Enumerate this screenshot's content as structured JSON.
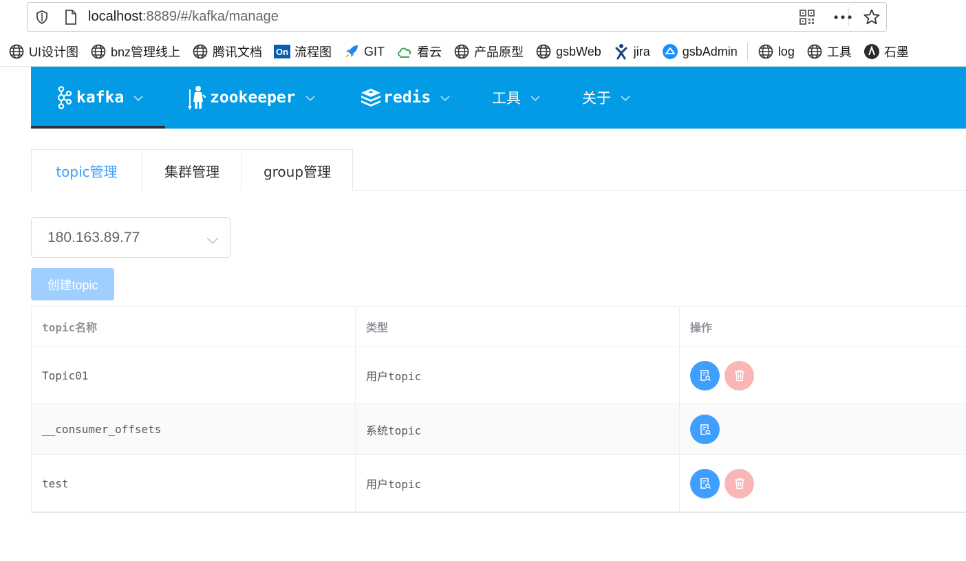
{
  "browser": {
    "url_host": "localhost",
    "url_rest": ":8889/#/kafka/manage",
    "icons": [
      "shield-icon",
      "page-icon",
      "qr-code-icon",
      "more-icon",
      "star-icon"
    ]
  },
  "bookmarks": [
    {
      "label": "UI设计图",
      "icon": "globe-icon"
    },
    {
      "label": "bnz管理线上",
      "icon": "globe-icon"
    },
    {
      "label": "腾讯文档",
      "icon": "globe-icon"
    },
    {
      "label": "流程图",
      "icon": "on-logo-icon"
    },
    {
      "label": "GIT",
      "icon": "rocket-icon"
    },
    {
      "label": "看云",
      "icon": "cloud-icon"
    },
    {
      "label": "产品原型",
      "icon": "globe-icon"
    },
    {
      "label": "gsbWeb",
      "icon": "globe-icon"
    },
    {
      "label": "jira",
      "icon": "jira-icon"
    },
    {
      "label": "gsbAdmin",
      "icon": "admin-icon"
    },
    {
      "label": "log",
      "icon": "globe-icon"
    },
    {
      "label": "工具",
      "icon": "globe-icon"
    },
    {
      "label": "石墨",
      "icon": "shimo-icon"
    }
  ],
  "nav": {
    "color": "#039be5",
    "items": [
      {
        "label": "kafka",
        "icon": "kafka-icon",
        "active": true
      },
      {
        "label": "zookeeper",
        "icon": "zookeeper-icon"
      },
      {
        "label": "redis",
        "icon": "redis-icon"
      },
      {
        "label": "工具"
      },
      {
        "label": "关于"
      }
    ]
  },
  "tabs": [
    {
      "label": "topic管理",
      "active": true
    },
    {
      "label": "集群管理"
    },
    {
      "label": "group管理"
    }
  ],
  "cluster_select": {
    "value": "180.163.89.77"
  },
  "create_button": {
    "label": "创建topic",
    "disabled": true
  },
  "table": {
    "headers": [
      "topic名称",
      "类型",
      "操作"
    ],
    "rows": [
      {
        "name": "Topic01",
        "type": "用户topic",
        "actions": [
          "view",
          "delete"
        ]
      },
      {
        "name": "__consumer_offsets",
        "type": "系统topic",
        "actions": [
          "view"
        ]
      },
      {
        "name": "test",
        "type": "用户topic",
        "actions": [
          "view",
          "delete"
        ]
      }
    ]
  }
}
